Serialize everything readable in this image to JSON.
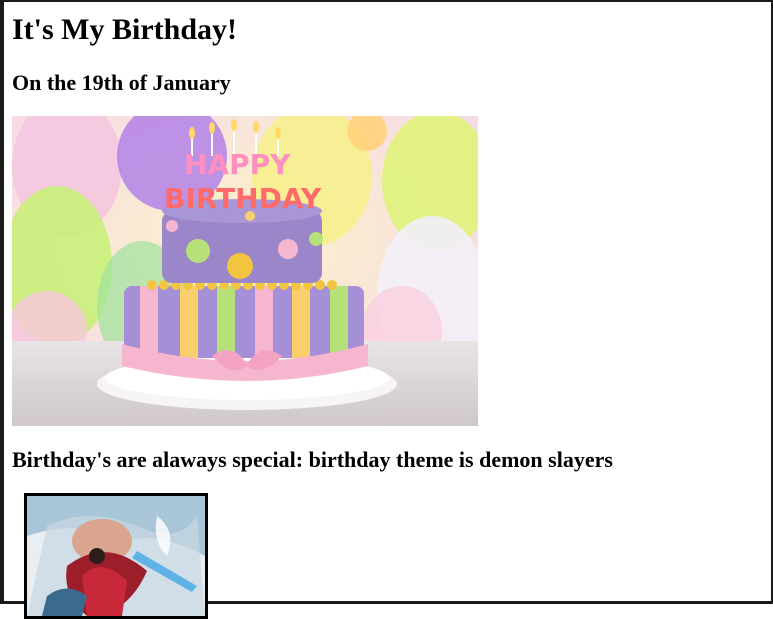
{
  "page": {
    "title": "It's My Birthday!",
    "date_heading": "On the 19th of January",
    "theme_heading": "Birthday's are alaways special: birthday theme is demon slayers"
  },
  "cake_image": {
    "candles_line1": "HAPPY",
    "candles_line2": "BIRTHDAY",
    "candle_colors": [
      "#ff5c8a",
      "#ffb347",
      "#7bd66b",
      "#5bc0ff",
      "#c084fc",
      "#ffe066",
      "#ff6b6b",
      "#4ade80"
    ]
  },
  "colors": {
    "border": "#1a1a1a",
    "cake_top": "#9b86c9",
    "cake_bottom": "#a58fd6",
    "frosting_pink": "#f7b6cf"
  }
}
